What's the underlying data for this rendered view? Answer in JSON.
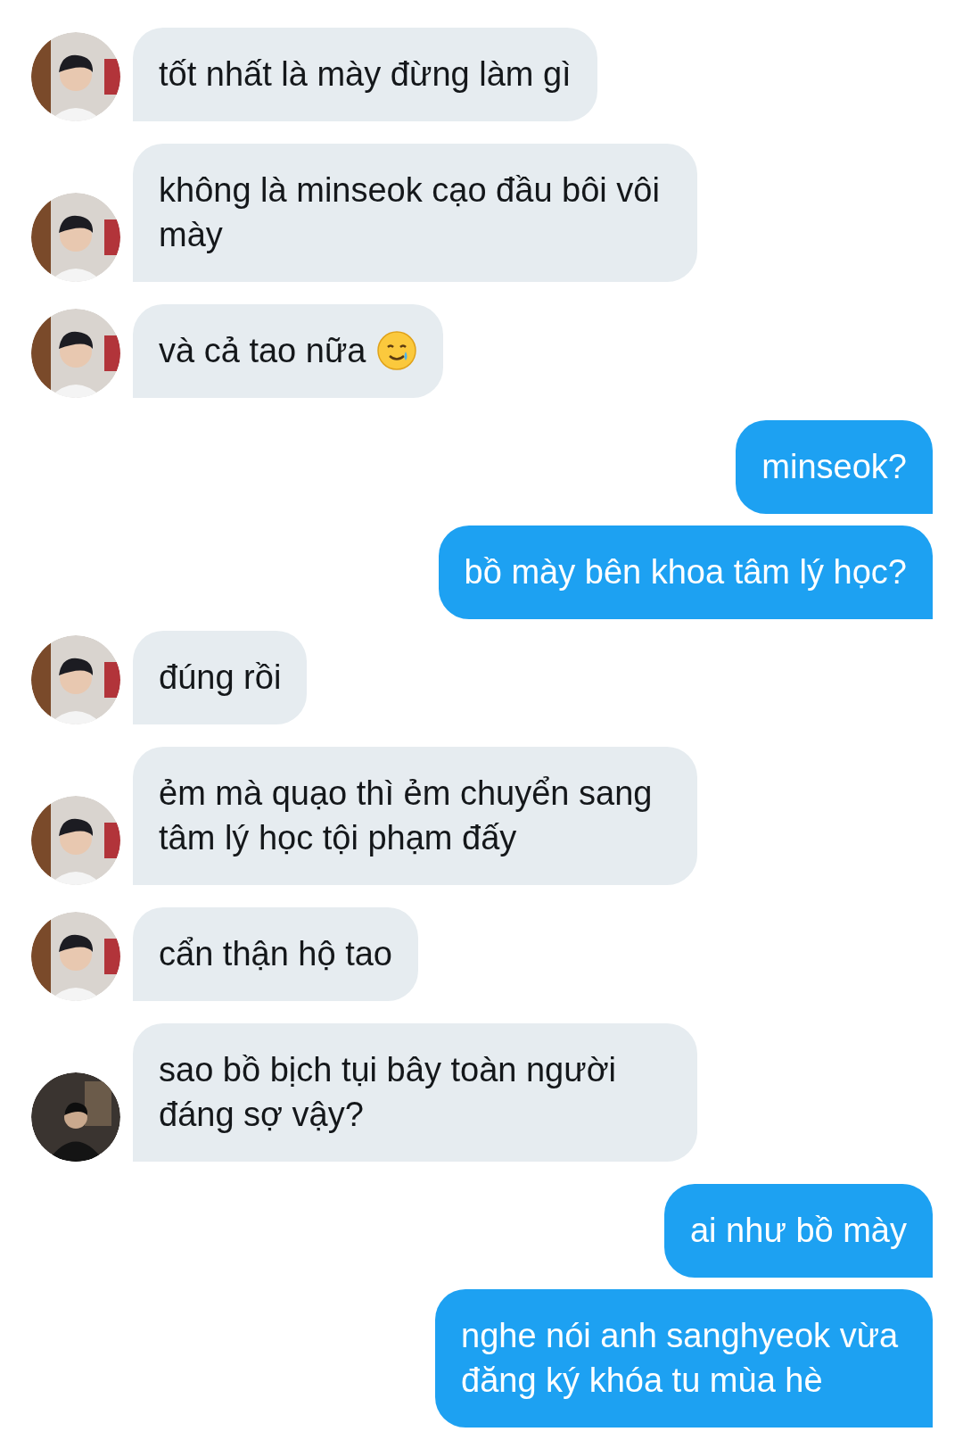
{
  "messages": [
    {
      "kind": "received",
      "avatar": {
        "kind": "light"
      },
      "text": "tốt nhất là mày đừng làm gì"
    },
    {
      "kind": "received",
      "avatar": {
        "kind": "light"
      },
      "text": "không là minseok cạo đầu bôi vôi mày"
    },
    {
      "kind": "received",
      "avatar": {
        "kind": "light"
      },
      "text": "và cả tao nữa",
      "icon": {
        "kind": "smile-tear"
      }
    },
    {
      "kind": "sent",
      "text": "minseok?"
    },
    {
      "kind": "sent",
      "text": "bồ mày bên khoa tâm lý học?"
    },
    {
      "kind": "received",
      "avatar": {
        "kind": "light"
      },
      "text": "đúng rồi"
    },
    {
      "kind": "received",
      "avatar": {
        "kind": "light"
      },
      "text": "ẻm mà quạo thì ẻm chuyển sang tâm lý học tội phạm đấy"
    },
    {
      "kind": "received",
      "avatar": {
        "kind": "light"
      },
      "text": "cẩn thận hộ tao"
    },
    {
      "kind": "received",
      "avatar": {
        "kind": "dark"
      },
      "text": "sao bồ bịch tụi bây toàn người đáng sợ vậy?"
    },
    {
      "kind": "sent",
      "text": "ai như bồ mày"
    },
    {
      "kind": "sent",
      "text": "nghe nói anh sanghyeok vừa đăng ký khóa tu mùa hè"
    }
  ]
}
